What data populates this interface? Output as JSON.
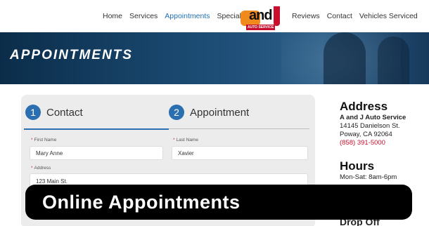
{
  "nav": {
    "items_left": [
      "Home",
      "Services",
      "Appointments",
      "Specials"
    ],
    "items_right": [
      "Reviews",
      "Contact",
      "Vehicles Serviced"
    ],
    "active": "Appointments",
    "accent_color": "#1f6fb2"
  },
  "logo": {
    "text": "and",
    "sub": "AUTO SERVICE"
  },
  "hero": {
    "title": "APPOINTMENTS"
  },
  "steps": [
    {
      "number": "1",
      "label": "Contact"
    },
    {
      "number": "2",
      "label": "Appointment"
    }
  ],
  "form": {
    "first_name_label": "First Name",
    "first_name_value": "Mary Anne",
    "last_name_label": "Last Name",
    "last_name_value": "Xavier",
    "address_label": "Address",
    "address_value": "123 Main St.",
    "required_mark": "*"
  },
  "sidebar": {
    "address_heading": "Address",
    "business_name": "A and J Auto Service",
    "street": "14145 Danielson St.",
    "city": "Poway, CA 92064",
    "phone": "(858) 391-5000",
    "hours_heading": "Hours",
    "hours_line": "Mon-Sat: 8am-6pm",
    "drop_heading": "Drop Off"
  },
  "banner": {
    "text": "Online Appointments"
  }
}
